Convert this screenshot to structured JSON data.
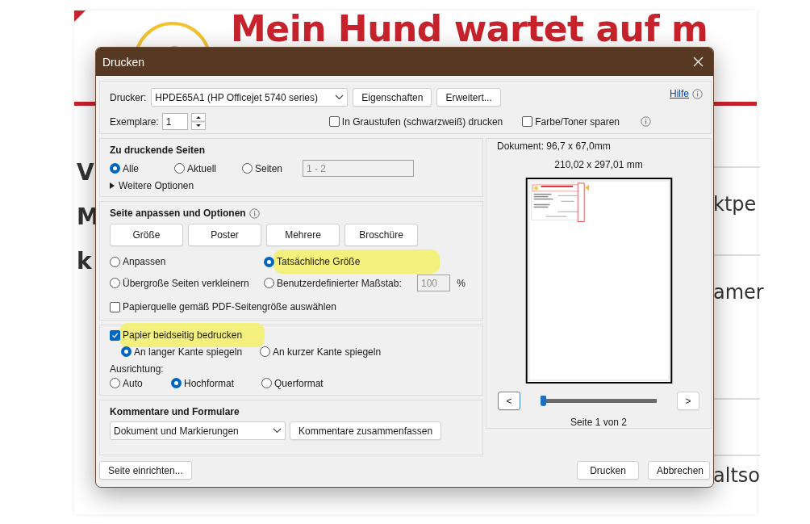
{
  "background_page": {
    "title": "Mein Hund wartet auf m",
    "left_fragments": [
      "V",
      "M",
      "k"
    ],
    "right_fragments": [
      "ktpe",
      "amer",
      "altso"
    ]
  },
  "dialog": {
    "title": "Drucken",
    "printer": {
      "label": "Drucker:",
      "value": "HPDE65A1 (HP Officejet 5740 series)",
      "buttons": [
        "Eigenschaften",
        "Erweitert..."
      ],
      "help": "Hilfe"
    },
    "copies": {
      "label": "Exemplare:",
      "value": "1"
    },
    "print_options": [
      {
        "label": "In Graustufen (schwarzweiß) drucken",
        "checked": false
      },
      {
        "label": "Farbe/Toner sparen",
        "checked": false
      }
    ],
    "pages_section": {
      "title": "Zu druckende Seiten",
      "radios": [
        {
          "label": "Alle",
          "selected": true
        },
        {
          "label": "Aktuell",
          "selected": false
        },
        {
          "label": "Seiten",
          "selected": false
        }
      ],
      "range_value": "1 - 2",
      "more_options": "Weitere Optionen"
    },
    "fit_section": {
      "title": "Seite anpassen und Optionen",
      "mode_buttons": [
        "Größe",
        "Poster",
        "Mehrere",
        "Broschüre"
      ],
      "size_radios": [
        {
          "label": "Anpassen",
          "selected": false,
          "highlighted": false
        },
        {
          "label": "Tatsächliche Größe",
          "selected": true,
          "highlighted": true
        },
        {
          "label": "Übergroße Seiten verkleinern",
          "selected": false,
          "highlighted": false
        },
        {
          "label": "Benutzerdefinierter Maßstab:",
          "selected": false,
          "highlighted": false
        }
      ],
      "scale_value": "100",
      "scale_unit": "%",
      "paper_source": {
        "label": "Papierquelle gemäß PDF-Seitengröße auswählen",
        "checked": false
      }
    },
    "duplex_section": {
      "duplex": {
        "label": "Papier beidseitig bedrucken",
        "checked": true,
        "highlighted": true
      },
      "flip_radios": [
        {
          "label": "An langer Kante spiegeln",
          "selected": true
        },
        {
          "label": "An kurzer Kante spiegeln",
          "selected": false
        }
      ],
      "orientation_label": "Ausrichtung:",
      "orientation_radios": [
        {
          "label": "Auto",
          "selected": false
        },
        {
          "label": "Hochformat",
          "selected": true
        },
        {
          "label": "Querformat",
          "selected": false
        }
      ]
    },
    "comments_section": {
      "title": "Kommentare und Formulare",
      "dropdown": "Dokument und Markierungen",
      "button": "Kommentare zusammenfassen"
    },
    "preview": {
      "document_size": "Dokument: 96,7 x 67,0mm",
      "paper_size": "210,02 x 297,01 mm",
      "prev": "<",
      "next": ">",
      "level": 0,
      "page_label": "Seite 1 von 2"
    },
    "footer": {
      "setup": "Seite einrichten...",
      "print": "Drucken",
      "cancel": "Abbrechen"
    }
  }
}
